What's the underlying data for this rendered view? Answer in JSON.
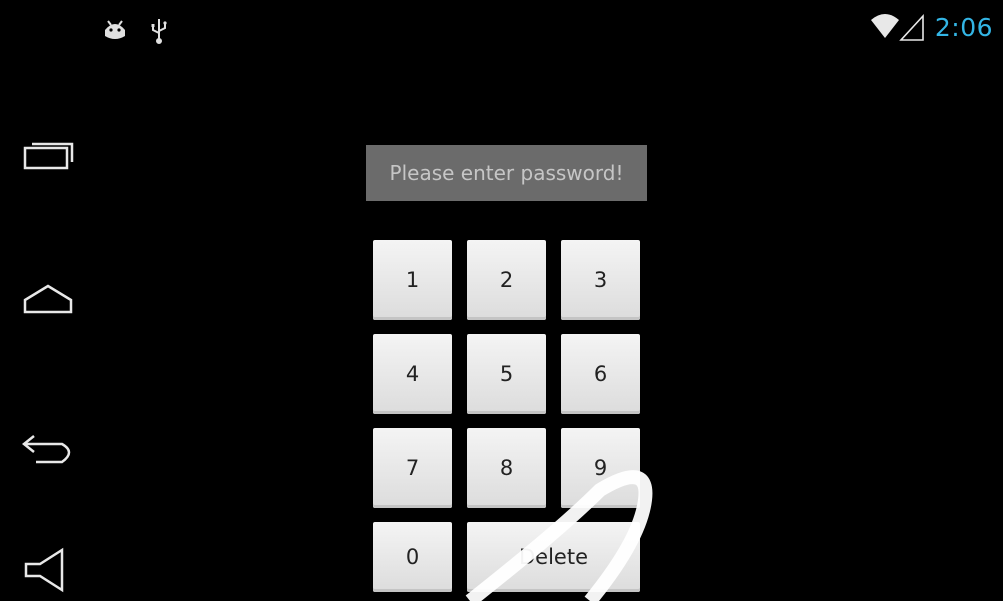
{
  "status_bar": {
    "left_icons": [
      "android-debug-icon",
      "usb-icon"
    ],
    "right_icons": [
      "wifi-icon",
      "signal-icon"
    ],
    "time": "2:06",
    "accent_color": "#33b5e5"
  },
  "nav_bar": {
    "buttons": [
      "recent-apps-icon",
      "home-icon",
      "back-icon",
      "volume-icon"
    ]
  },
  "prompt": {
    "text": "Please enter password!"
  },
  "keypad": {
    "keys": [
      "1",
      "2",
      "3",
      "4",
      "5",
      "6",
      "7",
      "8",
      "9",
      "0",
      "Delete"
    ]
  }
}
